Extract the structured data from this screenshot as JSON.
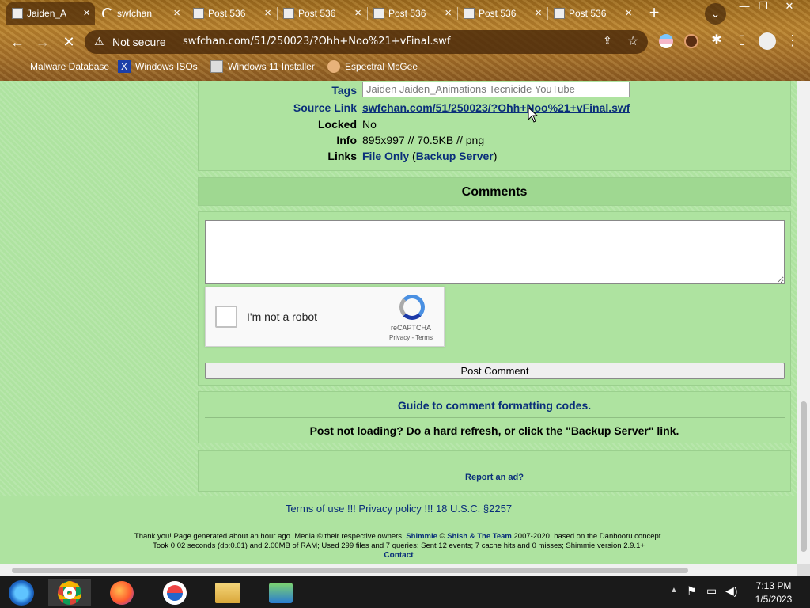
{
  "tabs": [
    {
      "label": "Jaiden_A",
      "active": true
    },
    {
      "label": "swfchan",
      "loading": true
    },
    {
      "label": "Post 536"
    },
    {
      "label": "Post 536"
    },
    {
      "label": "Post 536"
    },
    {
      "label": "Post 536"
    },
    {
      "label": "Post 536"
    }
  ],
  "toolbar": {
    "security": "Not secure",
    "url": "swfchan.com/51/250023/?Ohh+Noo%21+vFinal.swf"
  },
  "bookmarks": [
    "Malware Database",
    "Windows ISOs",
    "Windows 11 Installer",
    "Espectral McGee"
  ],
  "info": {
    "tags_label": "Tags",
    "tags_value": "Jaiden Jaiden_Animations Tecnicide YouTube",
    "source_label": "Source Link",
    "source_value": "swfchan.com/51/250023/?Ohh+Noo%21+vFinal.swf",
    "locked_label": "Locked",
    "locked_value": "No",
    "info_label": "Info",
    "info_value": "895x997 // 70.5KB // png",
    "links_label": "Links",
    "file_only": "File Only",
    "backup": "Backup Server",
    "paren_open": "(",
    "paren_close": ")"
  },
  "comments": {
    "heading": "Comments",
    "captcha_label": "I'm not a robot",
    "captcha_brand": "reCAPTCHA",
    "captcha_links": "Privacy - Terms",
    "post_button": "Post Comment"
  },
  "guide": {
    "link": "Guide to comment formatting codes.",
    "notice": "Post not loading? Do a hard refresh, or click the \"Backup Server\" link."
  },
  "ad": {
    "report": "Report an ad?"
  },
  "footer": {
    "terms": "Terms of use",
    "privacy": "Privacy policy",
    "usc": "18 U.S.C. §2257",
    "sep": " !!! ",
    "line1_a": "Thank you! Page generated about an hour ago. Media © their respective owners, ",
    "shimmie": "Shimmie",
    "by": " © ",
    "shish": "Shish & The Team",
    "line1_b": " 2007-2020, based on the Danbooru concept.",
    "line2": "Took 0.02 seconds (db:0.01) and 2.00MB of RAM; Used 299 files and 7 queries; Sent 12 events; 7 cache hits and 0 misses; Shimmie version 2.9.1+",
    "contact": "Contact"
  },
  "clock": {
    "time": "7:13 PM",
    "date": "1/5/2023"
  },
  "colors": {
    "page_bg": "#aee3a0",
    "link": "#0a2f7a"
  }
}
